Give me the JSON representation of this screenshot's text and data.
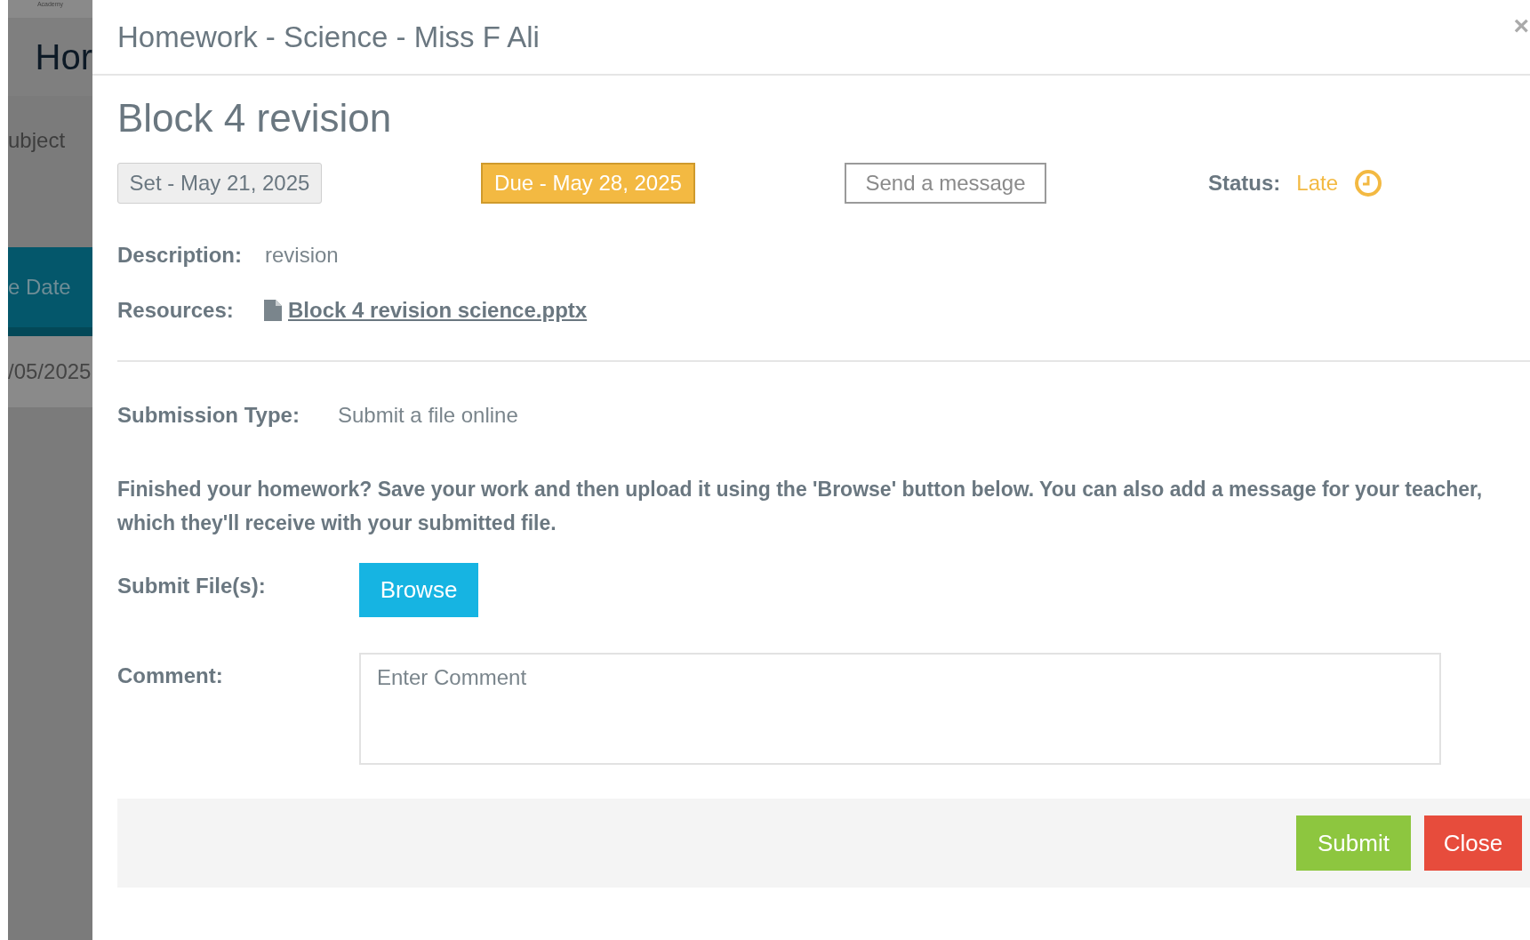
{
  "background_page": {
    "logo_text": "Academy",
    "heading": "Hor",
    "column_1": "ubject",
    "column_2": "e Date",
    "cell": "/05/2025"
  },
  "modal": {
    "title": "Homework - Science - Miss F Ali",
    "close": "×",
    "heading": "Block 4 revision",
    "set_date": "Set - May 21, 2025",
    "due_date": "Due - May 28, 2025",
    "message_button": "Send a message",
    "status": {
      "label": "Status:",
      "value": "Late"
    },
    "description": {
      "label": "Description:",
      "value": "revision"
    },
    "resources": {
      "label": "Resources:",
      "file": "Block 4 revision science.pptx"
    },
    "submission_type": {
      "label": "Submission Type:",
      "value": "Submit a file online"
    },
    "instructions": "Finished your homework? Save your work and then upload it using the 'Browse' button below. You can also add a message for your teacher, which they'll receive with your submitted file.",
    "submit_files": {
      "label": "Submit File(s):",
      "button": "Browse"
    },
    "comment": {
      "label": "Comment:",
      "placeholder": "Enter Comment"
    },
    "footer_buttons": [
      {
        "label": "Submit",
        "kind": "submit"
      },
      {
        "label": "Close",
        "kind": "close"
      }
    ]
  }
}
